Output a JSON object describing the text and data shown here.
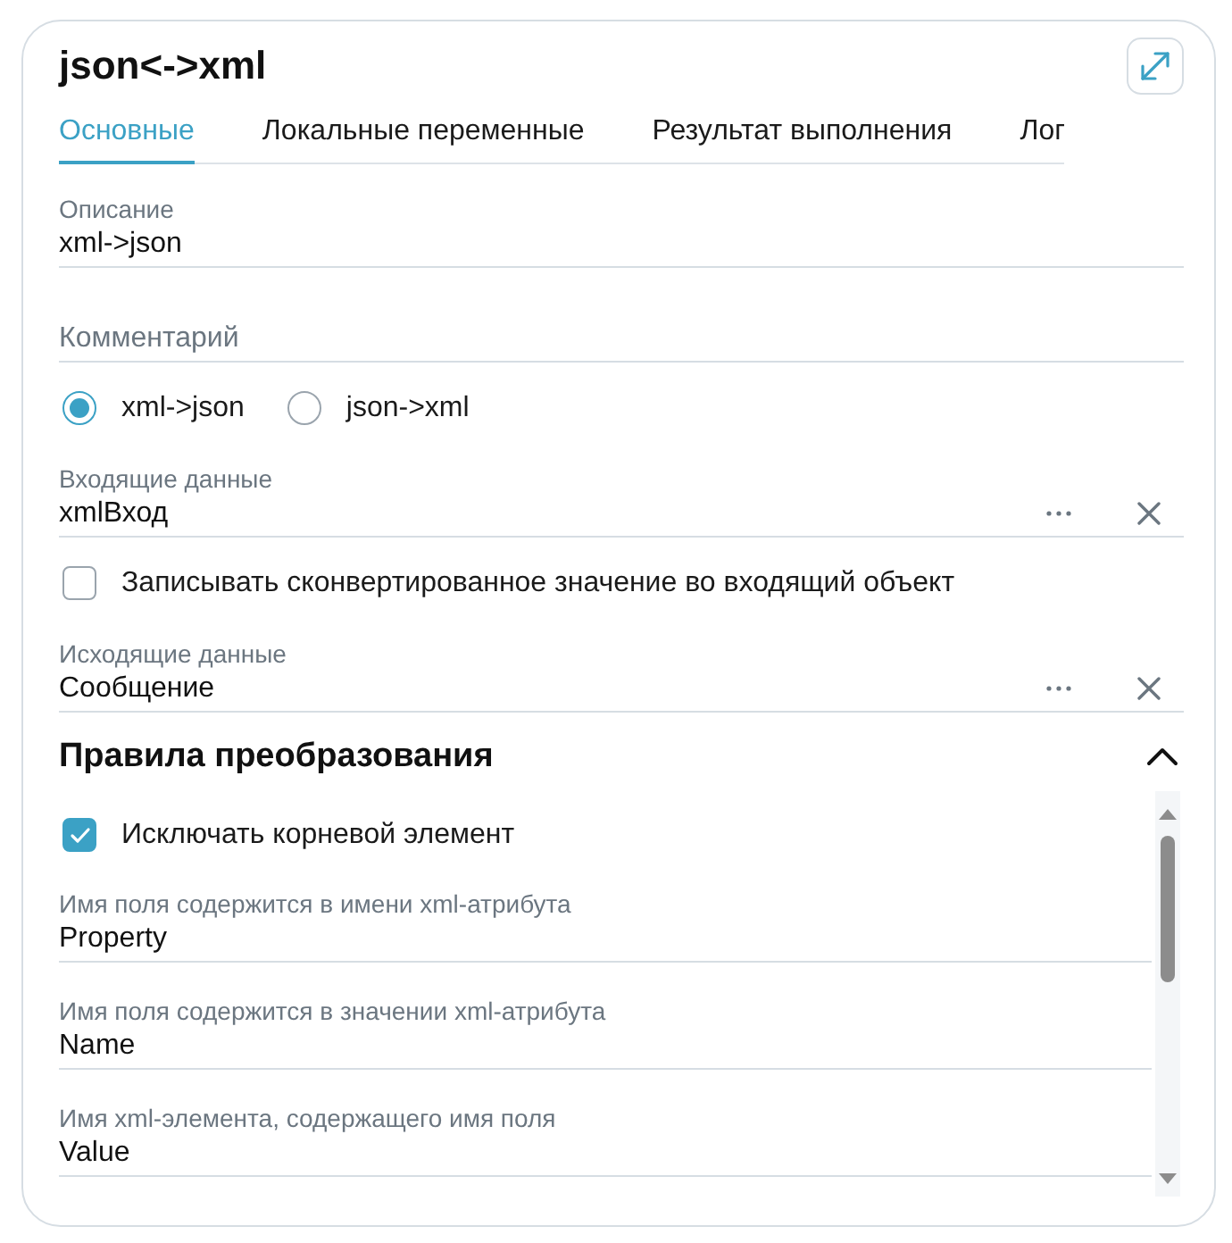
{
  "card": {
    "title": "json<->xml"
  },
  "tabs": [
    {
      "label": "Основные",
      "selected": true
    },
    {
      "label": "Локальные переменные",
      "selected": false
    },
    {
      "label": "Результат выполнения",
      "selected": false
    },
    {
      "label": "Лог",
      "selected": false
    }
  ],
  "fields": [
    {
      "kind": "text",
      "label": "Описание",
      "value": "xml->json"
    },
    {
      "kind": "text",
      "placeholder": "Комментарий"
    },
    {
      "kind": "radio",
      "options": [
        {
          "label": "xml->json",
          "selected": true
        },
        {
          "label": "json->xml",
          "selected": false
        }
      ]
    },
    {
      "kind": "picker",
      "label": "Входящие данные",
      "value": "xmlВход"
    },
    {
      "kind": "checkbox",
      "label": "Записывать сконвертированное значение во входящий объект",
      "checked": false
    },
    {
      "kind": "picker",
      "label": "Исходящие данные",
      "value": "Сообщение"
    }
  ],
  "rules": {
    "title": "Правила преобразования",
    "expanded": true,
    "fields": [
      {
        "kind": "checkbox",
        "label": "Исключать корневой элемент",
        "checked": true
      },
      {
        "kind": "text",
        "label": "Имя поля содержится в имени xml-атрибута",
        "value": "Property"
      },
      {
        "kind": "text",
        "label": "Имя поля содержится в значении xml-атрибута",
        "value": "Name"
      },
      {
        "kind": "text",
        "label": "Имя xml-элемента, содержащего имя поля",
        "value": "Value"
      }
    ]
  }
}
